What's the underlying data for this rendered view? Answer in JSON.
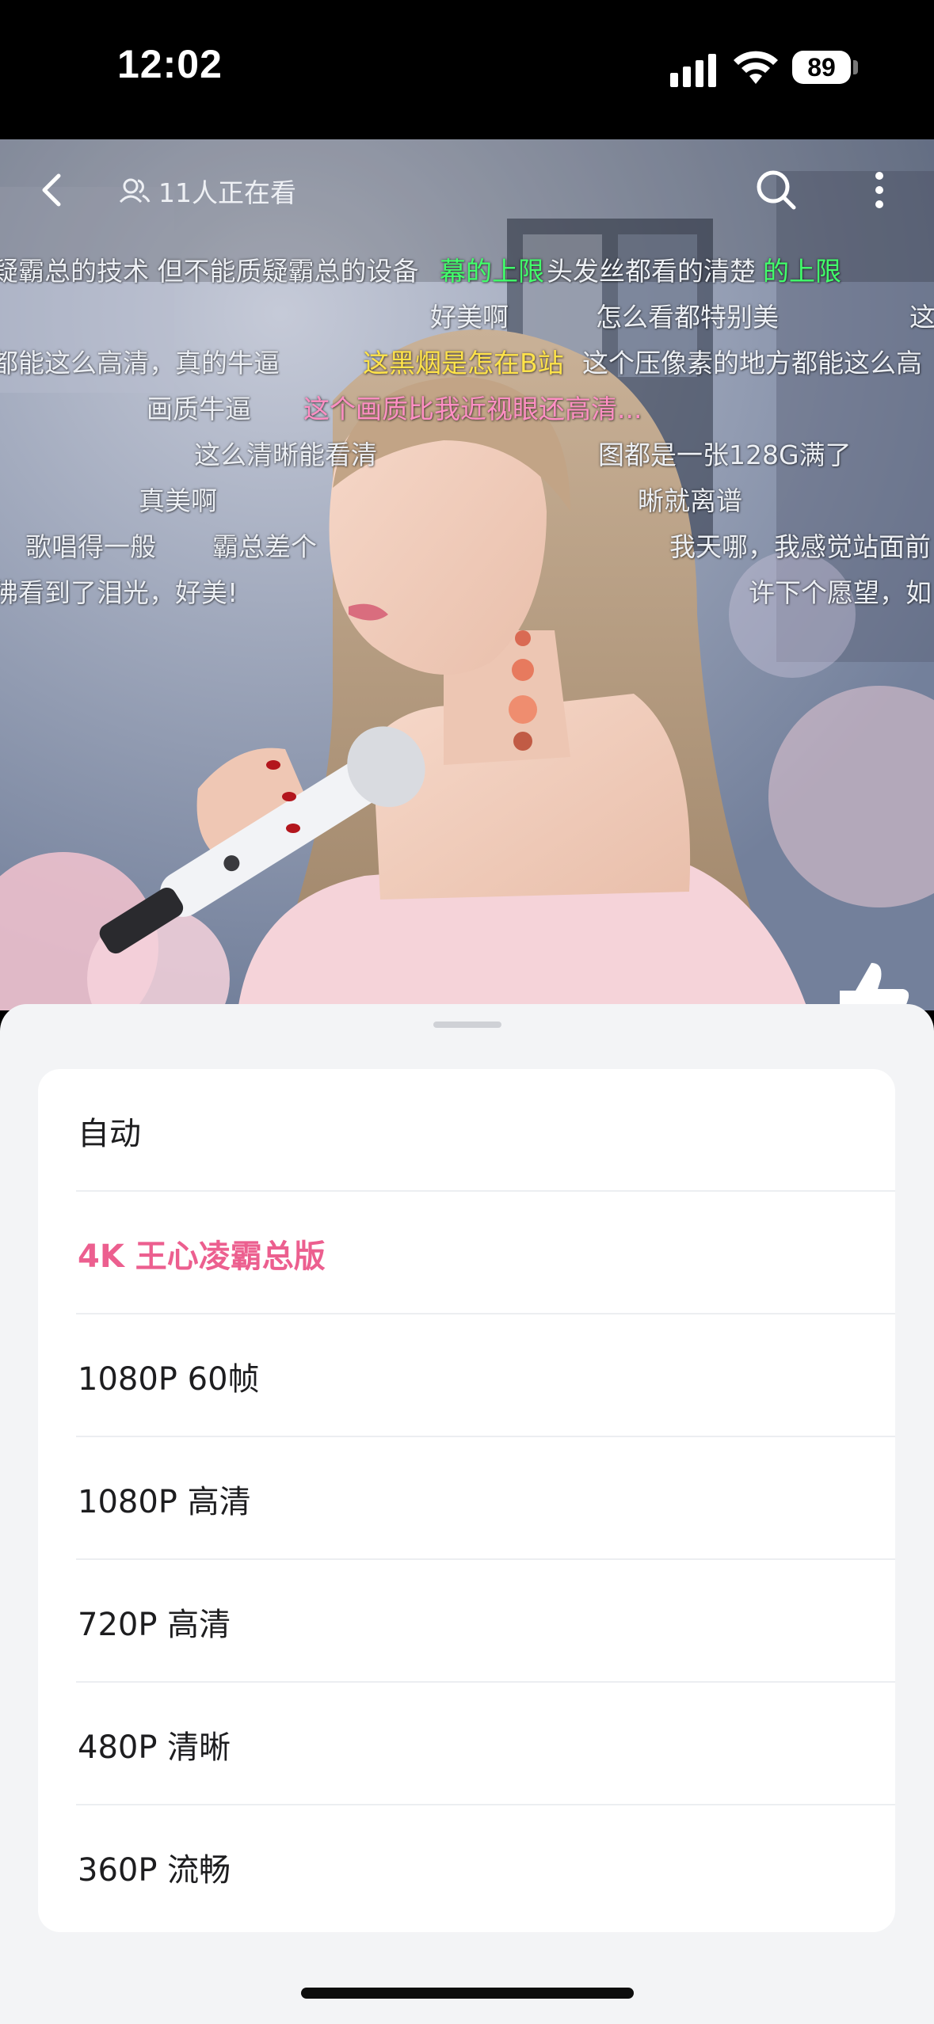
{
  "status_bar": {
    "time": "12:02",
    "battery": "89"
  },
  "video": {
    "viewers_text": "11人正在看",
    "danmaku": [
      "疑霸总的技术 但不能质疑霸总的设备",
      "幕的上限",
      "头发丝都看的清楚",
      "的上限",
      "好美啊",
      "怎么看都特别美",
      "这",
      "都能这么高清，真的牛逼",
      "这黑烟是怎在B站",
      "这个压像素的地方都能这么高",
      "画质牛逼",
      "这个画质比我近视眼还高清...",
      "这么清晰能看清",
      "图都是一张128G满了",
      "真美啊",
      "晰就离谱",
      "歌唱得一般",
      "霸总差个",
      "我天哪，我感觉站面前",
      "彿看到了泪光，好美!",
      "许下个愿望，如"
    ]
  },
  "quality_sheet": {
    "options": [
      {
        "label": "自动",
        "selected": false
      },
      {
        "label": "4K 王心凌霸总版",
        "selected": true
      },
      {
        "label": "1080P 60帧",
        "selected": false
      },
      {
        "label": "1080P 高清",
        "selected": false
      },
      {
        "label": "720P 高清",
        "selected": false
      },
      {
        "label": "480P 清晰",
        "selected": false
      },
      {
        "label": "360P 流畅",
        "selected": false
      }
    ],
    "selected_color": "#ec5f8f"
  },
  "icons": [
    "back-icon",
    "viewers-icon",
    "search-icon",
    "more-icon",
    "like-icon",
    "wifi-icon",
    "signal-icon",
    "battery-icon"
  ]
}
